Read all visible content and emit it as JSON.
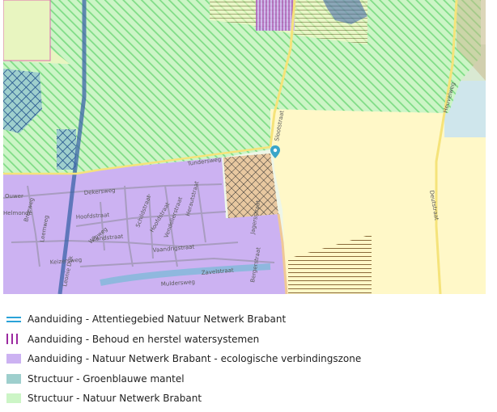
{
  "map": {
    "street_labels": [
      "Tundersweg",
      "Dekersweg",
      "Ouwer",
      "Breeweg",
      "Hoofdstraat",
      "Hoofdstraat",
      "Helmonde",
      "Zandstraat",
      "Keizersweg",
      "Leonie Dijk",
      "Leemweg",
      "Vaandrigstraat",
      "Muldersweg",
      "Herautstraat",
      "Schildstraat",
      "Vendelierstraat",
      "Zavelstraat",
      "Jagersstraat",
      "Wipweg",
      "Slootstraat",
      "Deutstraat",
      "Bergerstraat",
      "Heuvelweg"
    ],
    "colors": {
      "nnb_green": "#ccf5c6",
      "nnb_hatch": "#7fdc86",
      "purple_zone": "#ccb2f2",
      "yellow_zone": "#fff8c8",
      "teal_mantel": "#9ecfcd",
      "blue_line": "#2aa3d8"
    },
    "marker_icon": "map-pin-icon"
  },
  "legend": {
    "items": [
      {
        "symbol": "double-line-icon",
        "label": "Aanduiding - Attentiegebied Natuur Netwerk Brabant"
      },
      {
        "symbol": "vertical-bars-icon",
        "label": "Aanduiding - Behoud en herstel watersystemen"
      },
      {
        "symbol": "purple-swatch",
        "label": "Aanduiding - Natuur Netwerk Brabant - ecologische verbindingszone"
      },
      {
        "symbol": "teal-swatch",
        "label": "Structuur - Groenblauwe mantel"
      },
      {
        "symbol": "green-swatch",
        "label": "Structuur - Natuur Netwerk Brabant"
      }
    ]
  }
}
